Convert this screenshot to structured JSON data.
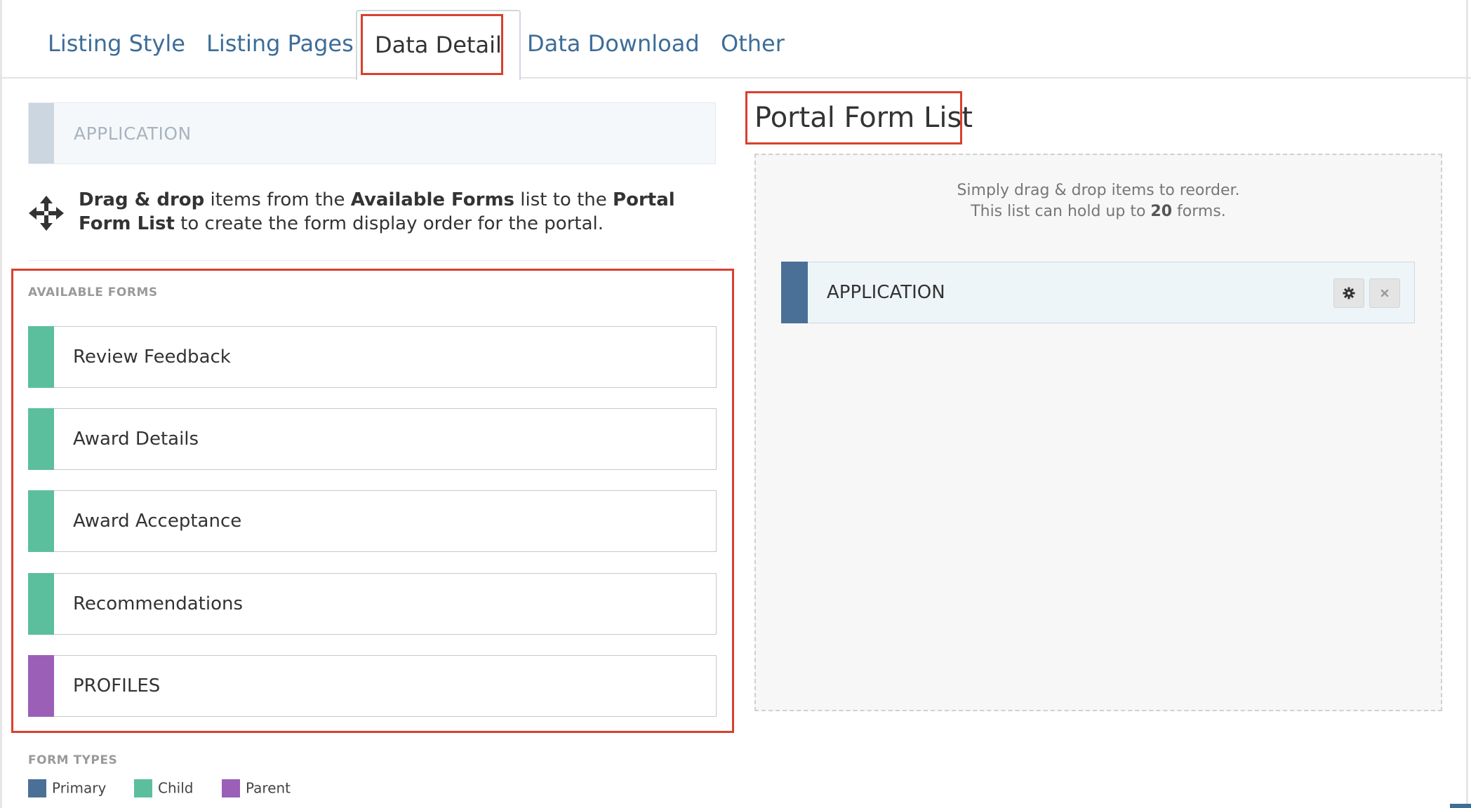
{
  "tabs": [
    {
      "label": "Listing Style",
      "active": false
    },
    {
      "label": "Listing Pages",
      "active": false
    },
    {
      "label": "Data Detail",
      "active": true
    },
    {
      "label": "Data Download",
      "active": false
    },
    {
      "label": "Other",
      "active": false
    }
  ],
  "selected_form": {
    "label": "APPLICATION"
  },
  "instructions": {
    "part1": "Drag & drop",
    "part2": " items from the ",
    "part3": "Available Forms",
    "part4": " list to the ",
    "part5": "Portal Form List",
    "part6": " to create the form display order for the portal."
  },
  "available_forms": {
    "heading": "AVAILABLE FORMS",
    "items": [
      {
        "label": "Review Feedback",
        "type": "Child"
      },
      {
        "label": "Award Details",
        "type": "Child"
      },
      {
        "label": "Award Acceptance",
        "type": "Child"
      },
      {
        "label": "Recommendations",
        "type": "Child"
      },
      {
        "label": "PROFILES",
        "type": "Parent"
      }
    ]
  },
  "portal_form_list": {
    "title": "Portal Form List",
    "hint_line1": "Simply drag & drop items to reorder.",
    "hint_line2_pre": "This list can hold up to ",
    "hint_line2_num": "20",
    "hint_line2_post": " forms.",
    "items": [
      {
        "label": "APPLICATION",
        "type": "Primary"
      }
    ]
  },
  "form_types": {
    "heading": "FORM TYPES",
    "items": [
      {
        "label": "Primary",
        "color": "#4a7097"
      },
      {
        "label": "Child",
        "color": "#5bbf9e"
      },
      {
        "label": "Parent",
        "color": "#9b5fb8"
      }
    ]
  },
  "colors": {
    "primary": "#4a7097",
    "child": "#5bbf9e",
    "parent": "#9b5fb8",
    "link": "#3d6d98",
    "highlight": "#d8412f"
  }
}
